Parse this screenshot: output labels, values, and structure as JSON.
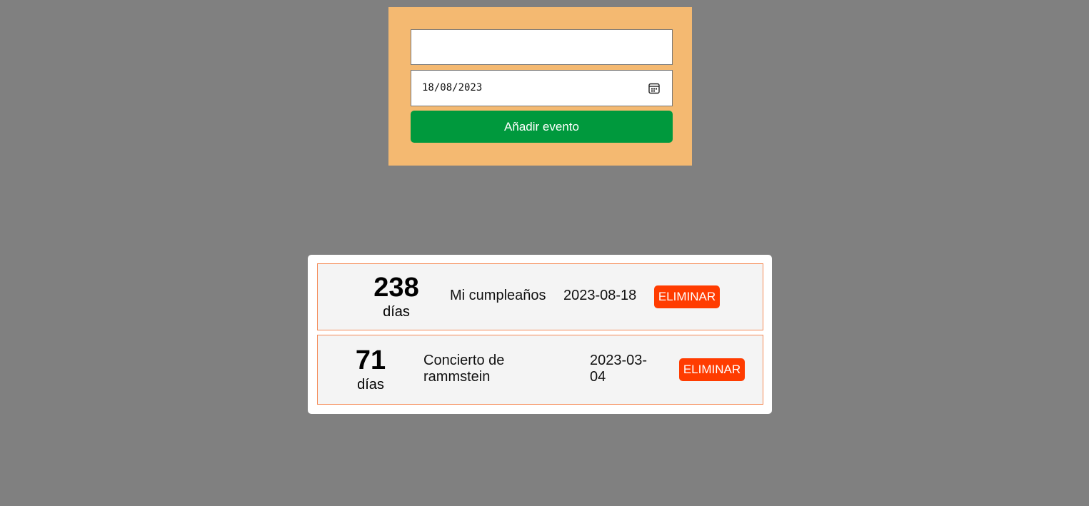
{
  "form": {
    "title_value": "",
    "date_value": "18/08/2023",
    "add_button_label": "Añadir evento"
  },
  "events": [
    {
      "days": "238",
      "days_unit": "días",
      "name": "Mi cumpleaños",
      "date": "2023-08-18",
      "delete_label": "ELIMINAR"
    },
    {
      "days": "71",
      "days_unit": "días",
      "name_line1": "Concierto de",
      "name_line2": "rammstein",
      "date_line1": "2023-03-",
      "date_line2": "04",
      "delete_label": "ELIMINAR"
    }
  ],
  "colors": {
    "background": "#808080",
    "form_panel": "#f4b971",
    "add_button": "#00993d",
    "delete_button": "#ff3c00",
    "card_border": "#f58a55"
  }
}
